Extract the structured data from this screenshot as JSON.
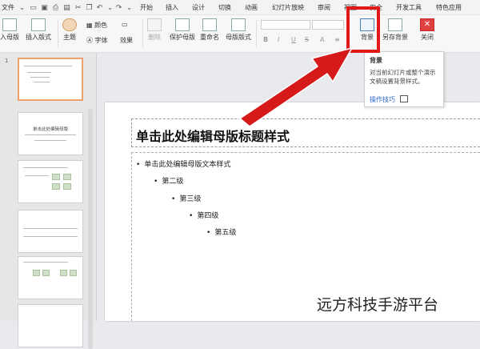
{
  "menubar": {
    "file": "文件",
    "tabs": [
      "开始",
      "插入",
      "设计",
      "切换",
      "动画",
      "幻灯片放映",
      "审阅",
      "视图",
      "安全",
      "开发工具",
      "特色应用"
    ]
  },
  "ribbon": {
    "insert_master": "入母版",
    "insert_layout": "插入版式",
    "theme": "主题",
    "colors": "颜色",
    "fonts": "字体",
    "effects": "效果",
    "delete": "删除",
    "preserve_master": "保护母版",
    "rename": "重命名",
    "master_layout": "母版版式",
    "background": "背景",
    "save_background": "另存背景",
    "close": "关闭",
    "format": [
      "B",
      "I",
      "U",
      "S"
    ]
  },
  "tooltip": {
    "title": "背景",
    "description": "对当前幻灯片或整个演示文稿设置背景样式。",
    "link": "操作技巧"
  },
  "slide": {
    "title": "单击此处编辑母版标题样式",
    "levels": [
      "单击此处编辑母版文本样式",
      "第二级",
      "第三级",
      "第四级",
      "第五级"
    ]
  },
  "thumbnails": {
    "slide2_title": "单击此处编辑母版"
  },
  "watermark": "远方科技手游平台",
  "colors": {
    "highlight": "#e01818",
    "arrow": "#d61a1a",
    "selected_thumb": "#f0a06a"
  }
}
